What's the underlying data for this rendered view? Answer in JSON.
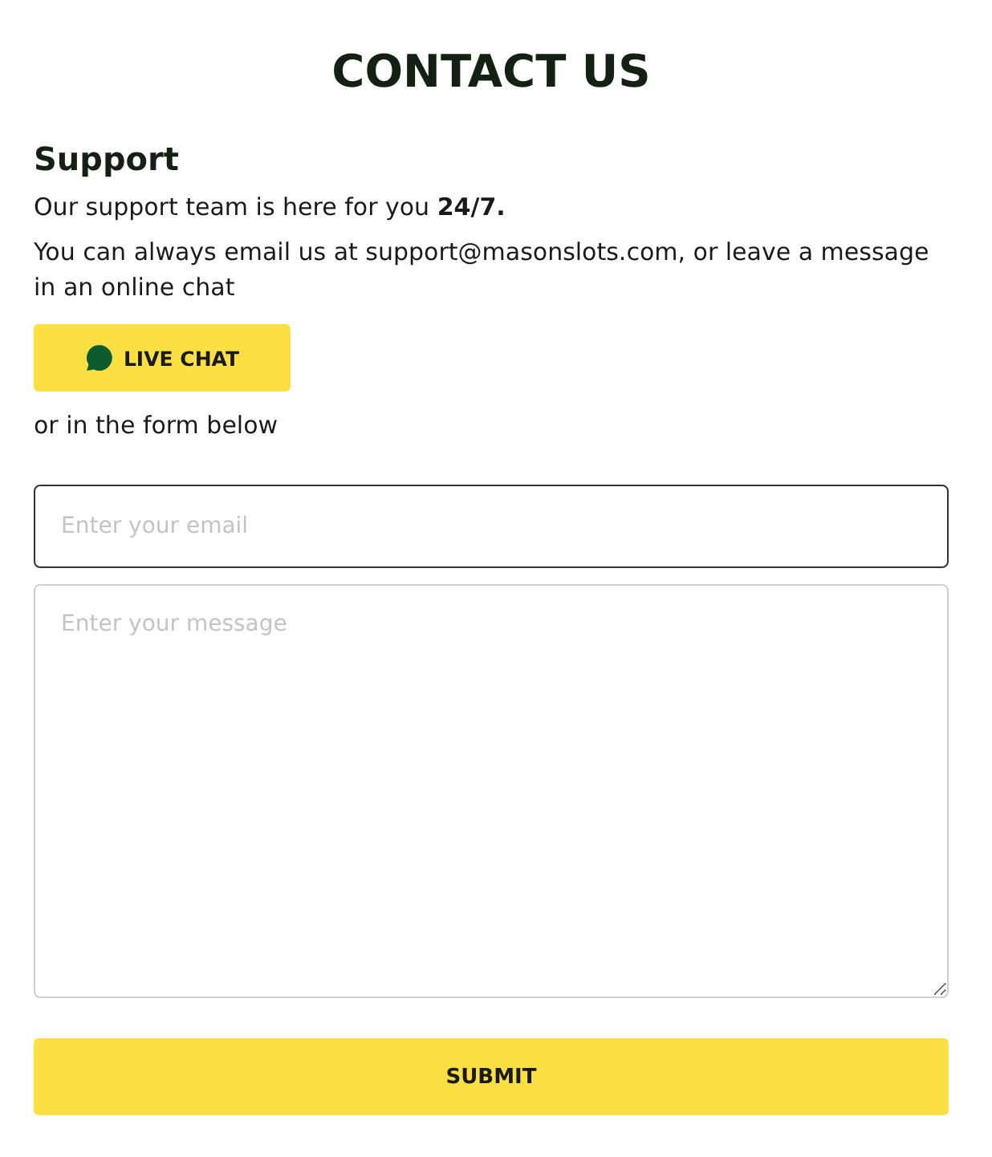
{
  "title": "CONTACT US",
  "support": {
    "heading": "Support",
    "lines": [
      "Our support team is here for you **24/7.**",
      "You can always email us at support@masonslots.com, or leave a message in an online chat"
    ],
    "chat_button": "LIVE CHAT",
    "after": "or in the form below"
  },
  "form": {
    "email": {
      "placeholder": "Enter your email",
      "focused": true
    },
    "message": {
      "placeholder": "Enter your message",
      "focused": false
    },
    "submit": "SUBMIT"
  }
}
